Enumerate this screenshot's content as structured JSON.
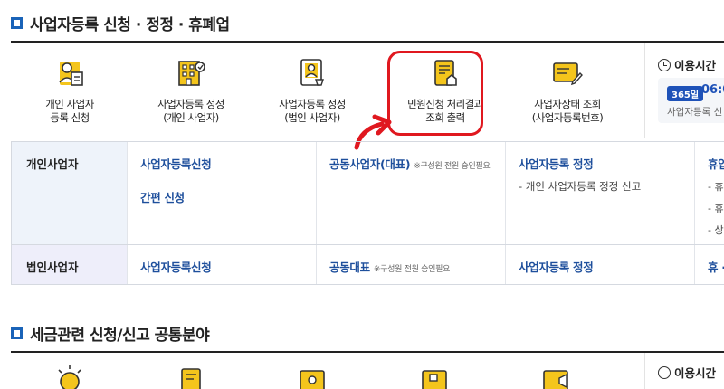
{
  "section1": {
    "title": "사업자등록 신청 · 정정 · 휴폐업",
    "services": [
      {
        "line1": "개인 사업자",
        "line2": "등록 신청",
        "icon": "person-document-icon"
      },
      {
        "line1": "사업자등록 정정",
        "line2": "(개인 사업자)",
        "icon": "building-icon"
      },
      {
        "line1": "사업자등록 정정",
        "line2": "(법인 사업자)",
        "icon": "certificate-person-icon"
      },
      {
        "line1": "민원신청 처리결과",
        "line2": "조회 출력",
        "icon": "document-house-icon"
      },
      {
        "line1": "사업자상태 조회",
        "line2": "(사업자등록번호)",
        "icon": "id-card-pen-icon"
      }
    ],
    "hours": {
      "title": "이용시간",
      "badge": "365일",
      "time": "06:0",
      "sub": "사업자등록 신"
    }
  },
  "table": {
    "rows": [
      {
        "header": "개인사업자",
        "col1": [
          "사업자등록신청",
          "간편 신청"
        ],
        "col2_link": "공동사업자(대표)",
        "col2_note": "※구성원 전원 승인필요",
        "col3_link": "사업자등록 정정",
        "col3_desc": "- 개인 사업자등록 정정 신고",
        "col4_link": "휴업",
        "col4_items": [
          "- 휴",
          "- 휴",
          "- 상"
        ]
      },
      {
        "header": "법인사업자",
        "col1": [
          "사업자등록신청"
        ],
        "col2_link": "공동대표",
        "col2_note": "※구성원 전원 승인필요",
        "col3_link": "사업자등록 정정",
        "col4_link": "휴 ·"
      }
    ]
  },
  "section2": {
    "title": "세금관련 신청/신고 공통분야",
    "hours_title": "이용시간",
    "icons": [
      "lightbulb-icon",
      "document-pen-icon",
      "certificate-icon",
      "certificate-stamp-icon",
      "card-megaphone-icon"
    ]
  },
  "colors": {
    "accent": "#1e4f9c",
    "highlight": "#e0181f",
    "icon_yellow": "#f4c51c",
    "header_bg": "#eef3fa"
  }
}
